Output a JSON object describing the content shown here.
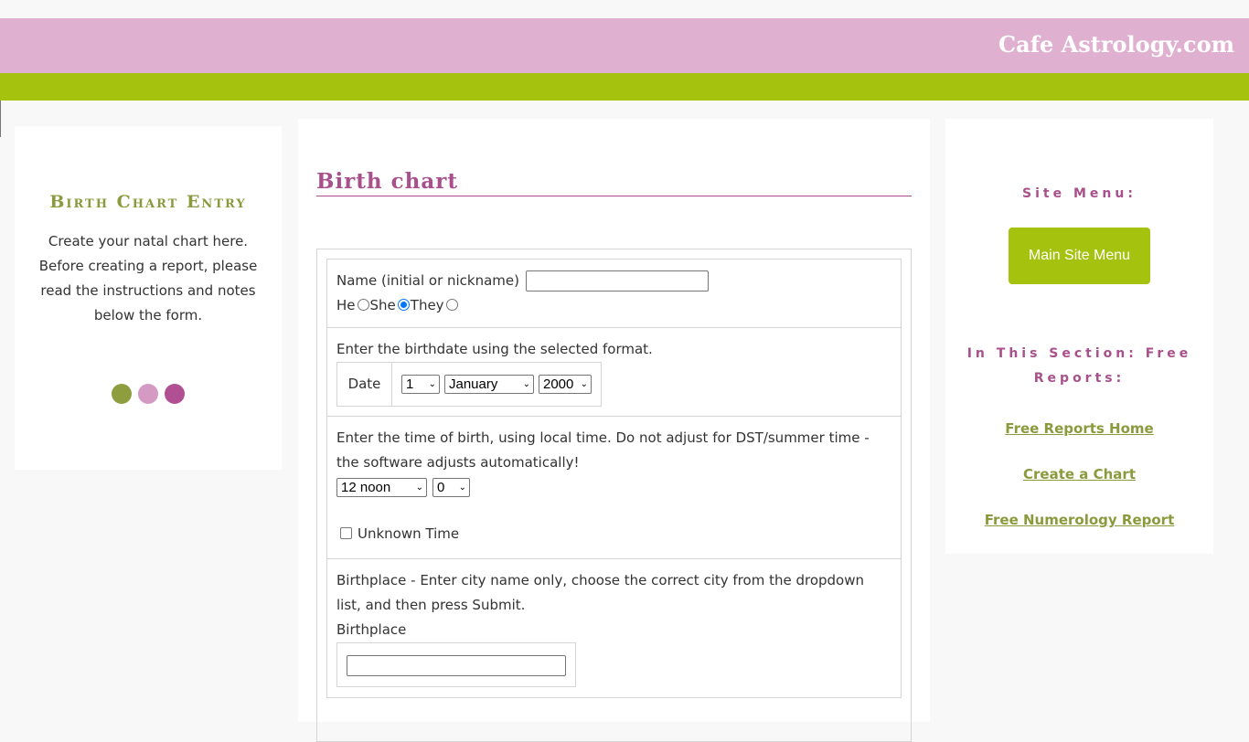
{
  "header": {
    "site_title": "Cafe Astrology.com",
    "colors": {
      "header_bg": "#e0b0d0",
      "bar": "#a5c20f"
    }
  },
  "left_sidebar": {
    "title": "Birth Chart Entry",
    "description": "Create your natal chart here. Before creating a report, please read the instructions and notes below the form.",
    "dots": [
      "#8e9e3f",
      "#d49ac4",
      "#b04f91"
    ]
  },
  "main": {
    "page_title": "Birth chart",
    "form": {
      "name_label": "Name (initial or nickname)",
      "name_value": "",
      "pronouns": [
        {
          "label": "He",
          "checked": false
        },
        {
          "label": "She",
          "checked": true
        },
        {
          "label": "They",
          "checked": false
        }
      ],
      "birthdate_instruction": "Enter the birthdate using the selected format.",
      "date_label": "Date",
      "day_value": "1",
      "month_value": "January",
      "year_value": "2000",
      "time_instruction": "Enter the time of birth, using local time. Do not adjust for DST/summer time - the software adjusts automatically!",
      "hour_value": "12 noon",
      "minute_value": "0",
      "unknown_time_label": "Unknown Time",
      "unknown_time_checked": false,
      "birthplace_instruction": "Birthplace - Enter city name only, choose the correct city from the dropdown list, and then press Submit.",
      "birthplace_label": "Birthplace",
      "birthplace_value": ""
    }
  },
  "right_sidebar": {
    "site_menu_heading": "Site Menu:",
    "main_menu_button": "Main Site Menu",
    "section_heading": "In This Section: Free Reports:",
    "links": [
      {
        "label": "Free Reports Home"
      },
      {
        "label": "Create a Chart"
      },
      {
        "label": "Free Numerology Report"
      }
    ]
  }
}
